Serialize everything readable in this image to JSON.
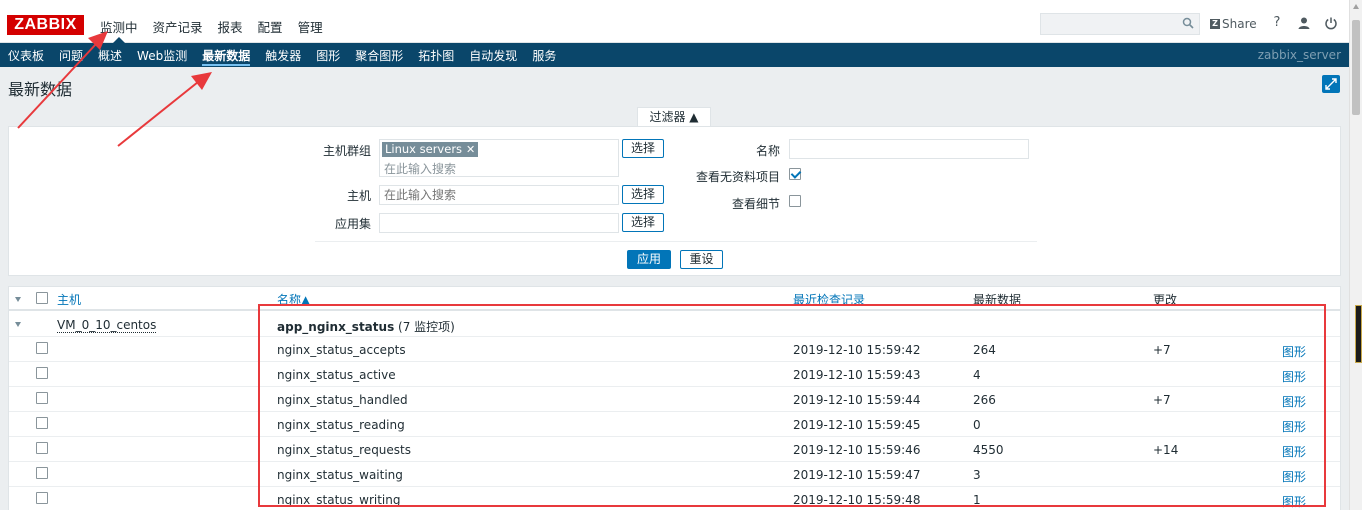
{
  "logo": "ZABBIX",
  "main_menu": [
    {
      "label": "监测中",
      "active": true
    },
    {
      "label": "资产记录",
      "active": false
    },
    {
      "label": "报表",
      "active": false
    },
    {
      "label": "配置",
      "active": false
    },
    {
      "label": "管理",
      "active": false
    }
  ],
  "header": {
    "search_placeholder": "",
    "share_label": "Share",
    "help_icon": "?"
  },
  "sub_menu": [
    {
      "label": "仪表板",
      "active": false
    },
    {
      "label": "问题",
      "active": false
    },
    {
      "label": "概述",
      "active": false
    },
    {
      "label": "Web监测",
      "active": false
    },
    {
      "label": "最新数据",
      "active": true
    },
    {
      "label": "触发器",
      "active": false
    },
    {
      "label": "图形",
      "active": false
    },
    {
      "label": "聚合图形",
      "active": false
    },
    {
      "label": "拓扑图",
      "active": false
    },
    {
      "label": "自动发现",
      "active": false
    },
    {
      "label": "服务",
      "active": false
    }
  ],
  "server_name": "zabbix_server",
  "page_title": "最新数据",
  "filter": {
    "tab_label": "过滤器 ▲",
    "host_group_label": "主机群组",
    "host_group_tag": "Linux servers",
    "host_group_placeholder": "在此输入搜索",
    "host_label": "主机",
    "host_placeholder": "在此输入搜索",
    "app_label": "应用集",
    "app_value": "",
    "select_label": "选择",
    "name_label": "名称",
    "name_value": "",
    "show_without_data_label": "查看无资料项目",
    "show_without_data": true,
    "show_details_label": "查看细节",
    "show_details": false,
    "apply_label": "应用",
    "reset_label": "重设"
  },
  "table": {
    "headers": {
      "host": "主机",
      "name": "名称▲",
      "last_check": "最近检查记录",
      "last_value": "最新数据",
      "change": "更改"
    },
    "host": "VM_0_10_centos",
    "app_name": "app_nginx_status",
    "app_count": "(7 监控项)",
    "graph_label": "图形",
    "rows": [
      {
        "name": "nginx_status_accepts",
        "last_check": "2019-12-10 15:59:42",
        "last_value": "264",
        "change": "+7"
      },
      {
        "name": "nginx_status_active",
        "last_check": "2019-12-10 15:59:43",
        "last_value": "4",
        "change": ""
      },
      {
        "name": "nginx_status_handled",
        "last_check": "2019-12-10 15:59:44",
        "last_value": "266",
        "change": "+7"
      },
      {
        "name": "nginx_status_reading",
        "last_check": "2019-12-10 15:59:45",
        "last_value": "0",
        "change": ""
      },
      {
        "name": "nginx_status_requests",
        "last_check": "2019-12-10 15:59:46",
        "last_value": "4550",
        "change": "+14"
      },
      {
        "name": "nginx_status_waiting",
        "last_check": "2019-12-10 15:59:47",
        "last_value": "3",
        "change": ""
      },
      {
        "name": "nginx_status_writing",
        "last_check": "2019-12-10 15:59:48",
        "last_value": "1",
        "change": ""
      }
    ]
  },
  "colors": {
    "nav_bg": "#0a466a",
    "accent": "#0275b8",
    "logo_red": "#d40000",
    "annotation_red": "#e8393c"
  }
}
